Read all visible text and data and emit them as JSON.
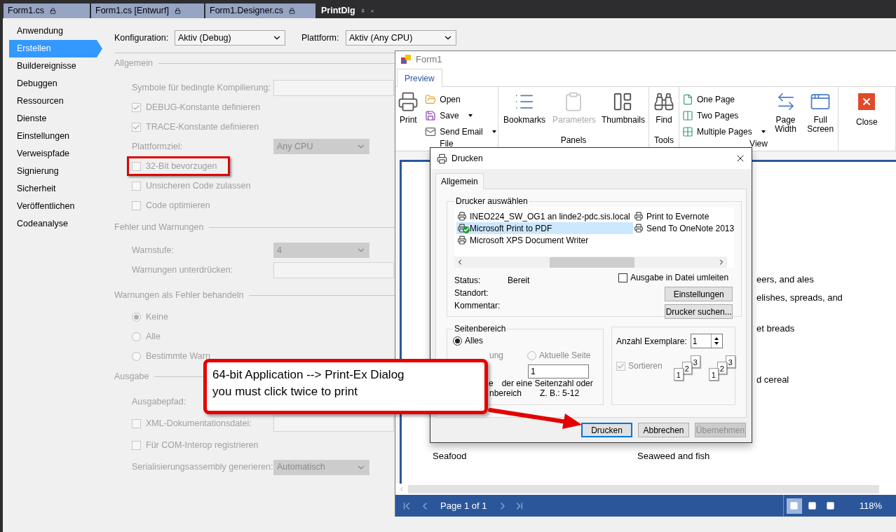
{
  "document_tabs": [
    {
      "label": "Form1.cs",
      "selected": false
    },
    {
      "label": "Form1.cs [Entwurf]",
      "selected": false
    },
    {
      "label": "Form1.Designer.cs",
      "selected": false
    },
    {
      "label": "PrintDlg",
      "selected": true
    }
  ],
  "sidebar": {
    "items": [
      {
        "label": "Anwendung",
        "selected": false
      },
      {
        "label": "Erstellen",
        "selected": true
      },
      {
        "label": "Buildereignisse",
        "selected": false
      },
      {
        "label": "Debuggen",
        "selected": false
      },
      {
        "label": "Ressourcen",
        "selected": false
      },
      {
        "label": "Dienste",
        "selected": false
      },
      {
        "label": "Einstellungen",
        "selected": false
      },
      {
        "label": "Verweispfade",
        "selected": false
      },
      {
        "label": "Signierung",
        "selected": false
      },
      {
        "label": "Sicherheit",
        "selected": false
      },
      {
        "label": "Veröffentlichen",
        "selected": false
      },
      {
        "label": "Codeanalyse",
        "selected": false
      }
    ]
  },
  "configuration": {
    "label": "Konfiguration:",
    "value": "Aktiv (Debug)"
  },
  "platform": {
    "label": "Plattform:",
    "value": "Aktiv (Any CPU)"
  },
  "build_settings": {
    "disabled": true,
    "sections": [
      {
        "title": "Allgemein",
        "rows": [
          {
            "kind": "text_field",
            "label": "Symbole für bedingte Kompilierung:"
          },
          {
            "kind": "checkbox",
            "label": "DEBUG-Konstante definieren",
            "checked": true,
            "highlighted": false
          },
          {
            "kind": "checkbox",
            "label": "TRACE-Konstante definieren",
            "checked": true,
            "highlighted": false
          },
          {
            "kind": "select",
            "label": "Plattformziel:",
            "value": "Any CPU"
          },
          {
            "kind": "checkbox",
            "label": "32-Bit bevorzugen",
            "checked": false,
            "highlighted": true
          },
          {
            "kind": "checkbox",
            "label": "Unsicheren Code zulassen",
            "checked": false,
            "highlighted": false
          },
          {
            "kind": "checkbox",
            "label": "Code optimieren",
            "checked": false,
            "highlighted": false
          }
        ]
      },
      {
        "title": "Fehler und Warnungen",
        "rows": [
          {
            "kind": "select",
            "label": "Warnstufe:",
            "value": "4"
          },
          {
            "kind": "text_field",
            "label": "Warnungen unterdrücken:"
          }
        ]
      },
      {
        "title": "Warnungen als Fehler behandeln",
        "rows": [
          {
            "kind": "radio",
            "label": "Keine",
            "selected": true
          },
          {
            "kind": "radio",
            "label": "Alle",
            "selected": false
          },
          {
            "kind": "radio",
            "label": "Bestimmte Warn",
            "selected": false
          }
        ]
      },
      {
        "title": "Ausgabe",
        "rows": [
          {
            "kind": "label",
            "label": "Ausgabepfad:"
          },
          {
            "kind": "checkbox_field",
            "label": "XML-Dokumentationsdatei:",
            "checked": false
          },
          {
            "kind": "checkbox",
            "label": "Für COM-Interop registrieren",
            "checked": false,
            "highlighted": false
          },
          {
            "kind": "select",
            "label": "Serialisierungsassembly generieren:",
            "value": "Automatisch"
          }
        ]
      }
    ]
  },
  "preview_window": {
    "title": "Form1",
    "tabs": [
      {
        "label": "Preview",
        "selected": true
      }
    ],
    "ribbon_groups": [
      {
        "label": "File",
        "items": [
          {
            "kind": "large",
            "label": "Print",
            "disabled": false,
            "dropdown": false
          },
          {
            "kind": "small",
            "label": "Open",
            "disabled": false,
            "dropdown": false
          },
          {
            "kind": "small",
            "label": "Save",
            "disabled": false,
            "dropdown": true
          },
          {
            "kind": "small",
            "label": "Send Email",
            "disabled": false,
            "dropdown": true
          }
        ]
      },
      {
        "label": "Panels",
        "items": [
          {
            "kind": "large",
            "label": "Bookmarks",
            "disabled": false,
            "dropdown": false
          },
          {
            "kind": "large",
            "label": "Parameters",
            "disabled": true,
            "dropdown": false
          },
          {
            "kind": "large",
            "label": "Thumbnails",
            "disabled": false,
            "dropdown": false
          }
        ]
      },
      {
        "label": "Tools",
        "items": [
          {
            "kind": "large",
            "label": "Find",
            "disabled": false,
            "dropdown": false
          }
        ]
      },
      {
        "label": "View",
        "items": [
          {
            "kind": "small",
            "label": "One Page",
            "disabled": false,
            "dropdown": false
          },
          {
            "kind": "small",
            "label": "Two Pages",
            "disabled": false,
            "dropdown": false
          },
          {
            "kind": "small",
            "label": "Multiple Pages",
            "disabled": false,
            "dropdown": true
          },
          {
            "kind": "large",
            "label": "Page Width",
            "disabled": false,
            "dropdown": false
          },
          {
            "kind": "large",
            "label": "Full Screen",
            "disabled": false,
            "dropdown": false
          }
        ]
      },
      {
        "items": [
          {
            "kind": "large",
            "label": "Close",
            "disabled": false,
            "dropdown": false
          }
        ]
      }
    ],
    "document_rows": [
      {
        "column_2": "eers, and ales"
      },
      {
        "column_2": "elishes, spreads, and"
      },
      {
        "column_2": "et breads"
      },
      {
        "column_2": "d cereal"
      },
      {
        "column_1": "Seafood",
        "column_2": "Seaweed and fish"
      }
    ],
    "status_bar": {
      "page": "Page 1 of 1",
      "views": [
        {
          "selected": true
        },
        {
          "selected": false
        },
        {
          "selected": false
        }
      ],
      "zoom": "118%"
    }
  },
  "print_dialog": {
    "title": "Drucken",
    "tabs": [
      {
        "label": "Allgemein",
        "selected": true
      }
    ],
    "printer_group": "Drucker auswählen",
    "printers": [
      {
        "name": "INEO224_SW_OG1 an linde2-pdc.sis.local",
        "selected": false,
        "default": false
      },
      {
        "name": "Microsoft Print to PDF",
        "selected": true,
        "default": true
      },
      {
        "name": "Microsoft XPS Document Writer",
        "selected": false,
        "default": false
      },
      {
        "name": "Print to Evernote",
        "selected": false,
        "default": false
      },
      {
        "name": "Send To OneNote 2013",
        "selected": false,
        "default": false
      }
    ],
    "info": [
      {
        "label": "Status:",
        "value": "Bereit"
      },
      {
        "label": "Standort:"
      },
      {
        "label": "Kommentar:"
      }
    ],
    "print_to_file": {
      "label": "Ausgabe in Datei umleiten",
      "checked": false
    },
    "printer_buttons": [
      "Einstellungen",
      "Drucker suchen..."
    ],
    "page_range": {
      "title": "Seitenbereich",
      "all": {
        "label": "Alles",
        "selected": true
      },
      "selection_fragment": "ung",
      "current_page": {
        "label": "Aktuelle Seite",
        "selected": false
      },
      "pages_value": "1",
      "hint_lines": [
        [
          "e",
          "der eine Seitenzahl oder"
        ],
        [
          "nbereich",
          "Z. B.: 5-12"
        ]
      ]
    },
    "copies": {
      "label": "Anzahl Exemplare:",
      "value": "1"
    },
    "collate": {
      "label": "Sortieren",
      "checked": true
    },
    "collate_stacks": [
      {
        "pages": [
          "1",
          "2",
          "3"
        ]
      },
      {
        "pages": [
          "1",
          "2",
          "3"
        ]
      }
    ],
    "buttons": [
      {
        "label": "Drucken",
        "default": true,
        "disabled": false
      },
      {
        "label": "Abbrechen",
        "default": false,
        "disabled": false
      },
      {
        "label": "Übernehmen",
        "default": false,
        "disabled": true
      }
    ]
  },
  "callout": {
    "lines": [
      "64-bit Application --> Print-Ex Dialog",
      "you must click twice to print"
    ]
  }
}
